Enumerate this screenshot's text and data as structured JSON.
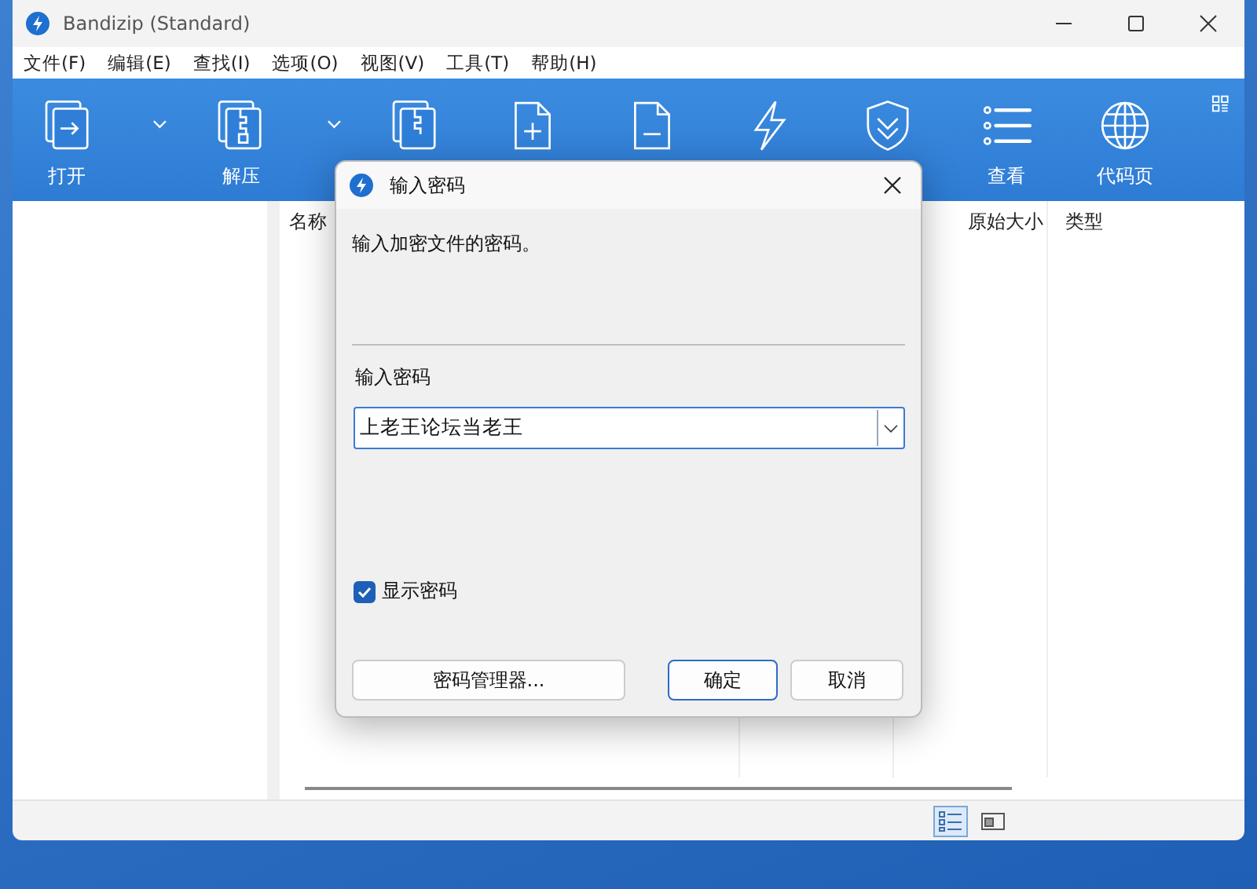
{
  "window": {
    "title": "Bandizip (Standard)"
  },
  "menu": [
    "文件(F)",
    "编辑(E)",
    "查找(I)",
    "选项(O)",
    "视图(V)",
    "工具(T)",
    "帮助(H)"
  ],
  "toolbar": [
    {
      "kind": "open",
      "label": "打开",
      "dropdown": true
    },
    {
      "kind": "extract",
      "label": "解压",
      "dropdown": true
    },
    {
      "kind": "zip",
      "dropdown": false
    },
    {
      "kind": "add",
      "dropdown": false
    },
    {
      "kind": "remove",
      "dropdown": false
    },
    {
      "kind": "bolt",
      "dropdown": false
    },
    {
      "kind": "shield",
      "dropdown": false
    },
    {
      "kind": "list",
      "label": "查看",
      "dropdown": false
    },
    {
      "kind": "globe",
      "label": "代码页",
      "dropdown": false
    }
  ],
  "file_list": {
    "columns": [
      "名称",
      "原始大小",
      "类型"
    ]
  },
  "dialog": {
    "title": "输入密码",
    "message": "输入加密文件的密码。",
    "field_label": "输入密码",
    "password": "上老王论坛当老王",
    "show_password": {
      "label": "显示密码",
      "checked": true
    },
    "buttons": [
      {
        "label": "密码管理器...",
        "default": false
      },
      {
        "label": "确定",
        "default": true
      },
      {
        "label": "取消",
        "default": false
      }
    ]
  }
}
